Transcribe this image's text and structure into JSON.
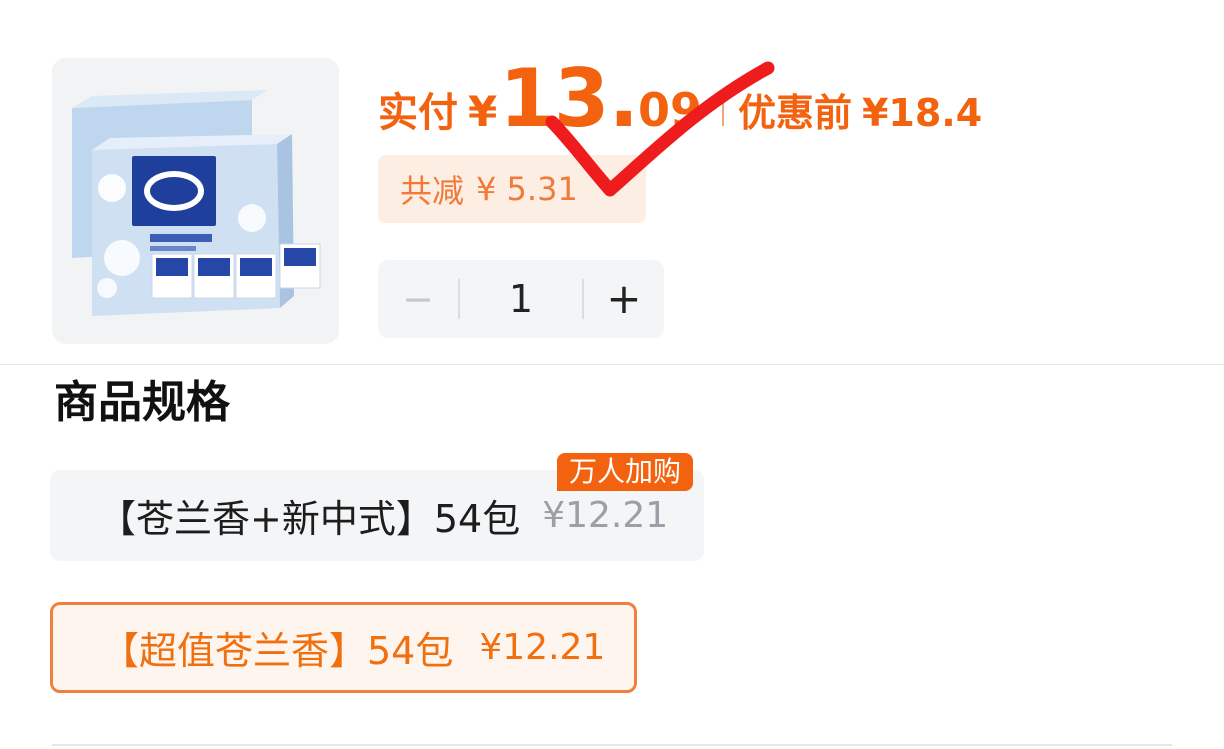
{
  "product": {
    "image_icon": "tissue-pack-image"
  },
  "price": {
    "label": "实付",
    "currency": "¥",
    "integer": "13.",
    "decimal": "09",
    "original_label": "优惠前",
    "original_value": "¥18.4",
    "accent_color": "#f2620f"
  },
  "discount": {
    "label": "共减",
    "value": "¥ 5.31"
  },
  "quantity": {
    "minus": "−",
    "value": "1",
    "plus": "+"
  },
  "specs": {
    "title": "商品规格",
    "options": [
      {
        "name": "【苍兰香+新中式】54包",
        "price": "¥12.21",
        "tag": "万人加购",
        "selected": false
      },
      {
        "name": "【超值苍兰香】54包",
        "price": "¥12.21",
        "selected": true
      }
    ]
  }
}
